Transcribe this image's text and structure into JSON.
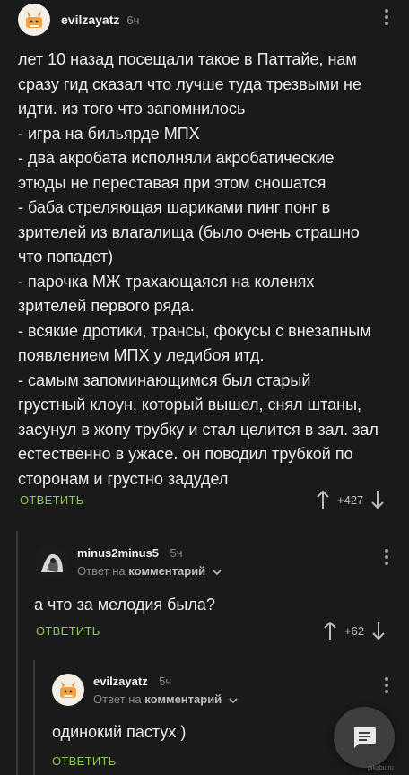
{
  "comment1": {
    "username": "evilzayatz",
    "time": "6ч",
    "text": "лет 10 назад посещали такое в Паттайе, нам\nсразу гид сказал что лучше туда трезвыми не\nидти. из того что запомнилось\n- игра на бильярде МПХ\n- два акробата исполняли акробатические\nэтюды не переставая при этом сношатся\n- баба стреляющая шариками пинг понг в\nзрителей из влагалища (было очень страшно\nчто попадет)\n- парочка МЖ трахающаяся на коленях\nзрителей первого ряда.\n- всякие дротики, трансы, фокусы с внезапным\nпоявлением МПХ у ледибоя итд.\n- самым запоминающимся был старый\nгрустный клоун, который вышел, снял штаны,\nзасунул в жопу трубку и стал целится в зал. зал\nестественно в ужасе. он поводил трубкой по\nсторонам и грустно задудел",
    "reply_label": "ОТВЕТИТЬ",
    "score": "+427"
  },
  "comment2": {
    "username": "minus2minus5",
    "time": "5ч",
    "reply_prefix": "Ответ на",
    "reply_target": "комментарий",
    "text": "а что за мелодия была?",
    "reply_label": "ОТВЕТИТЬ",
    "score": "+62"
  },
  "comment3": {
    "username": "evilzayatz",
    "time": "5ч",
    "reply_prefix": "Ответ на",
    "reply_target": "комментарий",
    "text": "одинокий пастух )",
    "reply_label": "ОТВЕТИТЬ"
  },
  "watermark": "pikabu.ru",
  "colors": {
    "background": "#1a1a1a",
    "accent_green": "#8ac858",
    "text": "#ececec",
    "muted": "#8a8a8a"
  }
}
